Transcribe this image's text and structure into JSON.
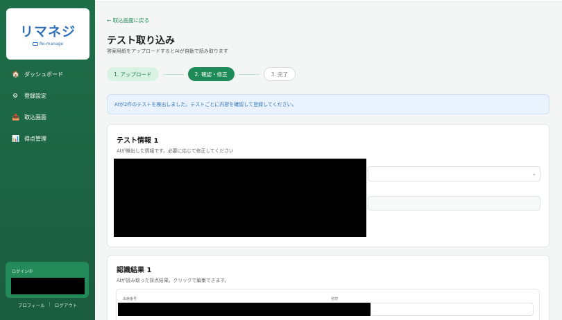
{
  "sidebar": {
    "logo": {
      "text": "リマネジ",
      "sub": "Re-manage"
    },
    "items": [
      {
        "icon": "home-icon",
        "glyph": "🏠",
        "label": "ダッシュボード"
      },
      {
        "icon": "gear-icon",
        "glyph": "⚙",
        "label": "登録設定"
      },
      {
        "icon": "inbox-tray-icon",
        "glyph": "📥",
        "label": "取込画面"
      },
      {
        "icon": "bar-chart-icon",
        "glyph": "📊",
        "label": "得点管理"
      }
    ],
    "login_label": "ログイン中",
    "profile_link": "プロフィール",
    "separator": "|",
    "logout_link": "ログアウト"
  },
  "main": {
    "back_link": "← 取込画面に戻る",
    "title": "テスト取り込み",
    "subtitle": "答案用紙をアップロードするとAIが自動で読み取ります",
    "steps": [
      {
        "label": "1. アップロード",
        "state": "done"
      },
      {
        "label": "2. 確認・修正",
        "state": "active"
      },
      {
        "label": "3. 完了",
        "state": "todo"
      }
    ],
    "alert": "AIが2件のテストを検出しました。テストごとに内容を確認して登録してください。",
    "test_info": {
      "title": "テスト情報 1",
      "subtitle": "AIが検出した情報です。必要に応じて修正してください"
    },
    "recognition": {
      "title": "認識結果 1",
      "subtitle": "AIが読み取った採点結果。クリックで編集できます。",
      "columns": [
        "出席番号",
        "名前"
      ]
    }
  },
  "colors": {
    "sidebar": "#1f6e4a",
    "accent": "#1e8a57",
    "alert_bg": "#eaf3fd",
    "alert_text": "#2b6fb6"
  }
}
